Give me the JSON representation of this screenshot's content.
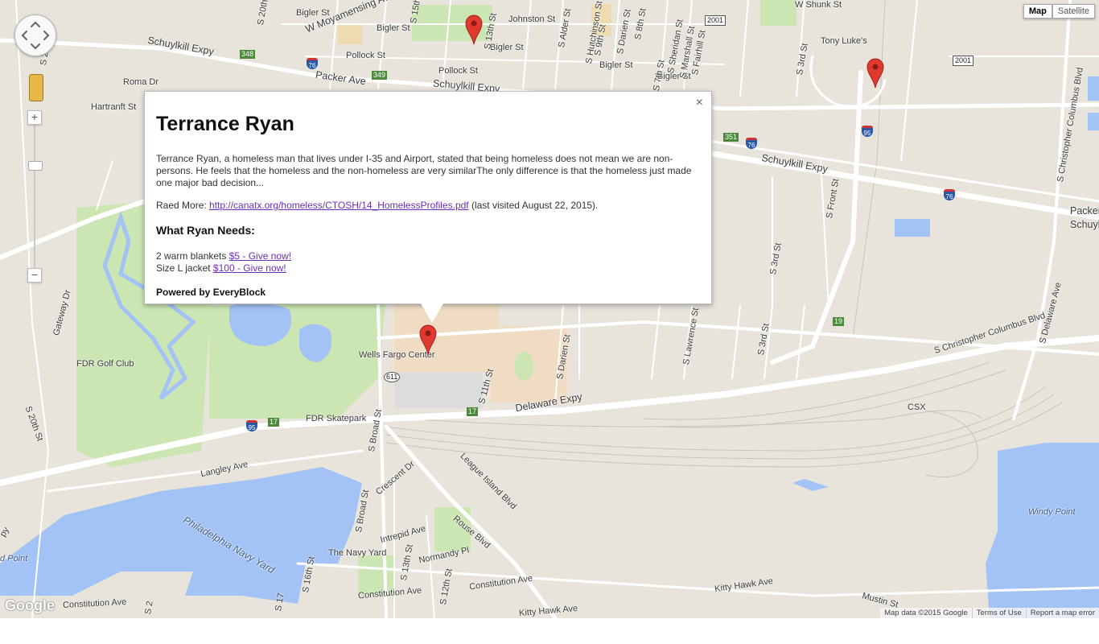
{
  "map_type": {
    "map_label": "Map",
    "satellite_label": "Satellite",
    "selected": "Map"
  },
  "info_window": {
    "title": "Terrance Ryan",
    "description": "Terrance Ryan, a homeless man that lives under I-35 and Airport, stated that being homeless does not mean we are non-persons. He feels that the homeless and the non-homeless are very similarThe only difference is that the homeless just made one major bad decision...",
    "read_more_label": "Raed More: ",
    "read_more_link": "http://canatx.org/homeless/CTOSH/14_HomelessProfiles.pdf",
    "read_more_suffix": " (last visited August 22, 2015).",
    "needs_heading": "What Ryan Needs:",
    "needs": [
      {
        "item": "2 warm blankets ",
        "link": "$5 - Give now!"
      },
      {
        "item": "Size L jacket ",
        "link": "$100 - Give now!"
      }
    ],
    "powered_by": "Powered by EveryBlock",
    "close_glyph": "×"
  },
  "labels": {
    "schuylkill_expy_w": "Schuylkill Expy",
    "w_moyamensing": "W Moyamensing Ave",
    "bigler_1": "Bigler St",
    "bigler_2": "Bigler St",
    "bigler_3": "Bigler St",
    "bigler_4": "Bigler St",
    "bigler_5": "Bigler St",
    "johnston": "Johnston St",
    "pollock_1": "Pollock St",
    "pollock_2": "Pollock St",
    "packer_ave": "Packer Ave",
    "roma_dr": "Roma Dr",
    "hartranft": "Hartranft St",
    "s_26th": "S 26th St",
    "s_20th_top": "S 20th",
    "s_15th": "S 15th St",
    "s_13th_top": "S 13th St",
    "s_alder": "S Alder St",
    "s_hutchinson": "S Hutchinson St",
    "s_9th": "S 9th St",
    "s_darien_top": "S Darien St",
    "s_8th": "S 8th St",
    "s_7th": "S 7th St",
    "s_sheridan": "S Sheridan St",
    "s_marshall": "S Marshall St",
    "s_fairhill": "S Fairhill St",
    "w_shunk": "W Shunk St",
    "tony_lukes": "Tony Luke's",
    "s_3rd_top": "S 3rd St",
    "schuylkill_expy_e": "Schuylkill Expy",
    "s_front": "S Front St",
    "s_3rd_mid": "S 3rd St",
    "s_3rd_low": "S 3rd St",
    "s_lawrence": "S Lawrence St",
    "s_columbus_v": "S Christopher Columbus Blvd",
    "s_columbus_h": "S Christopher Columbus Blvd",
    "s_columbus_diag": "S Christopher Columbus Blvd",
    "s_delaware": "S Delaware Ave",
    "packer_e": "Packer Ave",
    "schuyl_e": "Schuyl",
    "gateway": "Gateway Dr",
    "fdr_golf": "FDR Golf Club",
    "wells_fargo": "Wells Fargo Center",
    "s_11th": "S 11th St",
    "s_darien_mid": "S Darien St",
    "delaware_expy": "Delaware Expy",
    "csx": "CSX",
    "fdr_skatepark": "FDR Skatepark",
    "s_20th_low": "S 20th St",
    "s_broad_1": "S Broad St",
    "s_broad_2": "S Broad St",
    "crescent": "Crescent Dr",
    "league_island": "League Island Blvd",
    "langley": "Langley Ave",
    "phila_navy_yard": "Philadelphia Navy Yard",
    "intrepid": "Intrepid Ave",
    "rouse": "Rouse Blvd",
    "navy_yard": "The Navy Yard",
    "normandy": "Normandy Pl",
    "s_16th": "S 16th St",
    "s_13th_low": "S 13th St",
    "s_12th": "S 12th St",
    "constitution_1": "Constitution Ave",
    "constitution_2": "Constitution Ave",
    "constitution_3": "Constitution Ave",
    "kitty_hawk_1": "Kitty Hawk Ave",
    "kitty_hawk_2": "Kitty Hawk Ave",
    "mustin": "Mustin St",
    "windy_point": "Windy Point",
    "d_point": "d Point",
    "py": "py",
    "s_17": "S 17",
    "s_2": "S 2"
  },
  "shields": {
    "r348": "348",
    "r349": "349",
    "r351": "351",
    "r19": "19",
    "r17a": "17",
    "r17b": "17",
    "r611": "611",
    "r2001a": "2001",
    "r2001b": "2001",
    "i76a": "76",
    "i76b": "76",
    "i76c": "76",
    "i95a": "95",
    "i95b": "95"
  },
  "footer": {
    "google_logo": "Google",
    "map_data": "Map data ©2015 Google",
    "terms": "Terms of Use",
    "report": "Report a map error"
  },
  "colors": {
    "land": "#e8e4dc",
    "water": "#a3c2f5",
    "park": "#cbe5b3",
    "road": "#ffffff",
    "link": "#6a2fb8",
    "pin": "#e03a30"
  }
}
